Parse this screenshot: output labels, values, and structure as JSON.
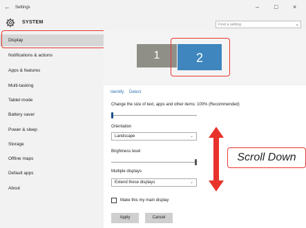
{
  "window": {
    "title": "Settings",
    "back_glyph": "←",
    "minimize_glyph": "–",
    "maximize_glyph": "□",
    "close_glyph": "×"
  },
  "header": {
    "section_title": "SYSTEM",
    "search_placeholder": "Find a setting",
    "search_glyph": "⌕"
  },
  "sidebar": {
    "items": [
      {
        "label": "Display",
        "selected": true
      },
      {
        "label": "Notifications & actions"
      },
      {
        "label": "Apps & features"
      },
      {
        "label": "Multi-tasking"
      },
      {
        "label": "Tablet mode"
      },
      {
        "label": "Battery saver"
      },
      {
        "label": "Power & sleep"
      },
      {
        "label": "Storage"
      },
      {
        "label": "Offline maps"
      },
      {
        "label": "Default apps"
      },
      {
        "label": "About"
      }
    ]
  },
  "display": {
    "monitor1": "1",
    "monitor2": "2",
    "identify_link": "Identify",
    "detect_link": "Detect",
    "scale_label": "Change the size of text, apps and other items: 100% (Recommended)",
    "orientation_label": "Orientation",
    "orientation_value": "Landscape",
    "brightness_label": "Brightness level",
    "multiple_displays_label": "Multiple displays",
    "multiple_displays_value": "Extend these displays",
    "main_display_checkbox": "Make this my main display",
    "apply_button": "Apply",
    "cancel_button": "Cancel",
    "chevron_glyph": "⌄"
  },
  "annotation": {
    "callout": "Scroll Down",
    "accent_color": "#e8332d"
  },
  "colors": {
    "monitor1": "#8f8f88",
    "monitor2": "#3e86bd",
    "sidebar_bg": "#f2f2f2",
    "selected_bg": "#d6d6d6",
    "link": "#2b6fb0"
  }
}
